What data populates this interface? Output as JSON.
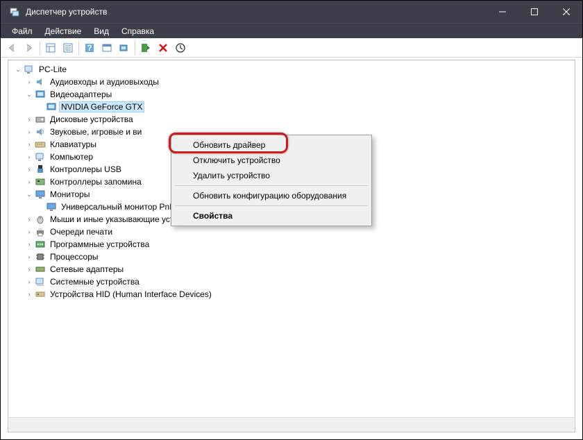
{
  "window": {
    "title": "Диспетчер устройств"
  },
  "menubar": {
    "file": "Файл",
    "action": "Действие",
    "view": "Вид",
    "help": "Справка"
  },
  "tree": {
    "root": "PC-Lite",
    "audio": "Аудиовходы и аудиовыходы",
    "video": "Видеоадаптеры",
    "gpu": "NVIDIA GeForce GTX",
    "disk": "Дисковые устройства",
    "sound": "Звуковые, игровые и ви",
    "keyboard": "Клавиатуры",
    "computer": "Компьютер",
    "usb": "Контроллеры USB",
    "storage": "Контроллеры запомина",
    "monitors": "Мониторы",
    "monitor_pnp": "Универсальный монитор PnP",
    "mice": "Мыши и иные указывающие устройства",
    "print": "Очереди печати",
    "software": "Программные устройства",
    "cpu": "Процессоры",
    "network": "Сетевые адаптеры",
    "system": "Системные устройства",
    "hid": "Устройства HID (Human Interface Devices)"
  },
  "context_menu": {
    "update": "Обновить драйвер",
    "disable": "Отключить устройство",
    "uninstall": "Удалить устройство",
    "scan": "Обновить конфигурацию оборудования",
    "properties": "Свойства"
  }
}
